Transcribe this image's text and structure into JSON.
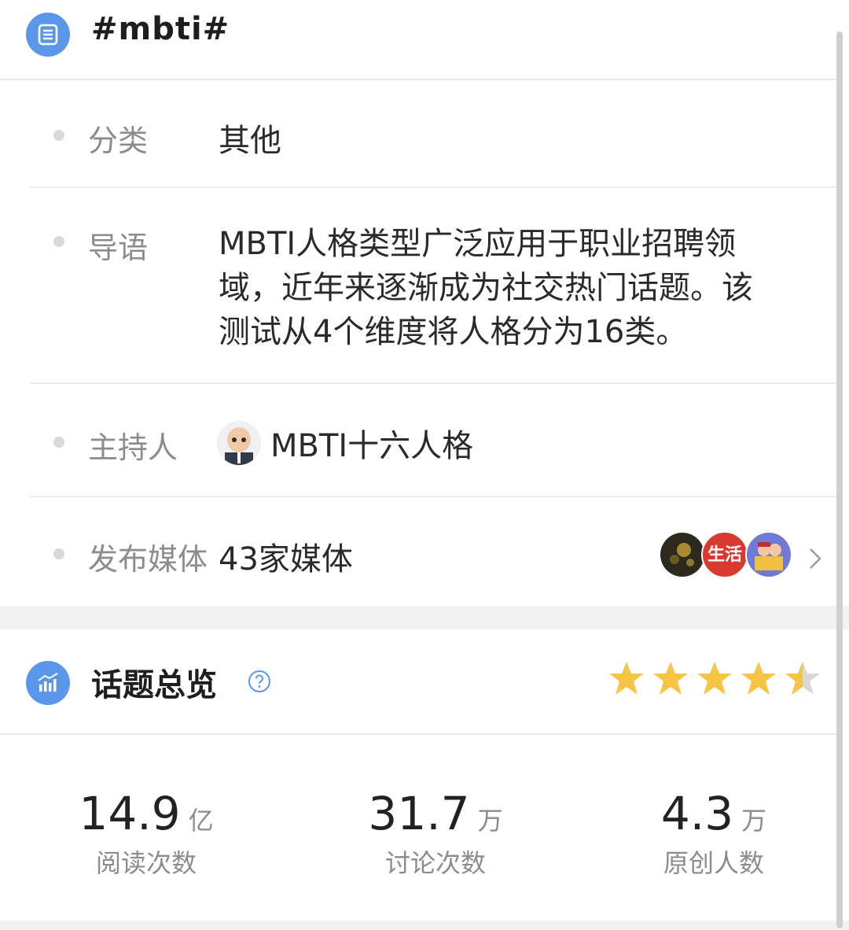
{
  "header": {
    "title": "#mbti#",
    "icon": "document-list-icon"
  },
  "details": {
    "category": {
      "label": "分类",
      "value": "其他"
    },
    "intro": {
      "label": "导语",
      "lines": [
        "MBTI人格类型广泛应用于职业招聘领",
        "域，近年来逐渐成为社交热门话题。该",
        "测试从4个维度将人格分为16类。"
      ]
    },
    "host": {
      "label": "主持人",
      "name": "MBTI十六人格",
      "avatar": "baby-avatar"
    },
    "media": {
      "label": "发布媒体",
      "value": "43家媒体",
      "avatars": [
        "media-avatar-dark",
        "media-avatar-生活",
        "media-avatar-cartoon"
      ],
      "avatar_text": "生活"
    }
  },
  "overview": {
    "title": "话题总览",
    "help_icon": "question-circle-icon",
    "rating": 4.5,
    "stats": [
      {
        "value": "14.9",
        "unit": "亿",
        "label": "阅读次数"
      },
      {
        "value": "31.7",
        "unit": "万",
        "label": "讨论次数"
      },
      {
        "value": "4.3",
        "unit": "万",
        "label": "原创人数"
      }
    ]
  },
  "colors": {
    "accent": "#5a97ea",
    "star": "#f6c544",
    "star_empty": "#d8d8d8",
    "label": "#8c8c8c"
  }
}
